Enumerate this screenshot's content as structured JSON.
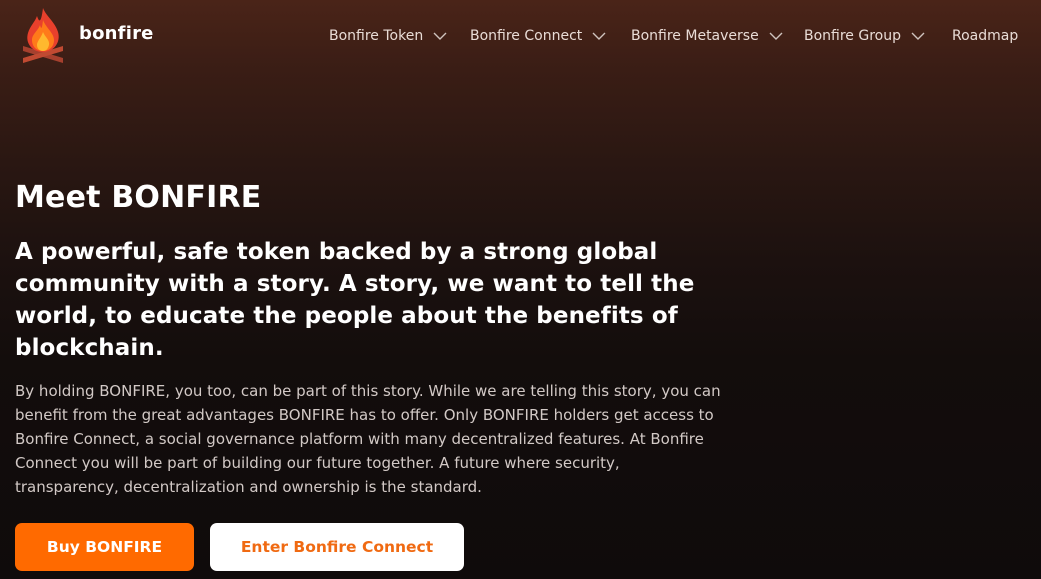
{
  "header": {
    "brand": "bonfire",
    "logo_icon": "bonfire-flame-logo",
    "nav": [
      {
        "label": "Bonfire Token",
        "has_dropdown": true
      },
      {
        "label": "Bonfire Connect",
        "has_dropdown": true
      },
      {
        "label": "Bonfire Metaverse",
        "has_dropdown": true
      },
      {
        "label": "Bonfire Group",
        "has_dropdown": true
      },
      {
        "label": "Roadmap",
        "has_dropdown": false
      }
    ]
  },
  "hero": {
    "title": "Meet BONFIRE",
    "subtitle": "A powerful, safe token backed by a strong global community with a story. A story, we want to tell the world, to educate the people about the benefits of blockchain.",
    "body": "By holding BONFIRE, you too, can be part of this story. While we are telling this story, you can benefit from the great advantages BONFIRE has to offer. Only BONFIRE holders get access to Bonfire Connect, a social governance platform with many decentralized features. At Bonfire Connect you will be part of building our future together. A future where security, transparency, decentralization and ownership is the standard.",
    "buttons": {
      "primary": "Buy BONFIRE",
      "secondary": "Enter Bonfire Connect"
    }
  },
  "colors": {
    "accent": "#ff6a00",
    "accent_text": "#f06a12",
    "background_top": "#4a2418",
    "background_bottom": "#0f0b0b"
  }
}
